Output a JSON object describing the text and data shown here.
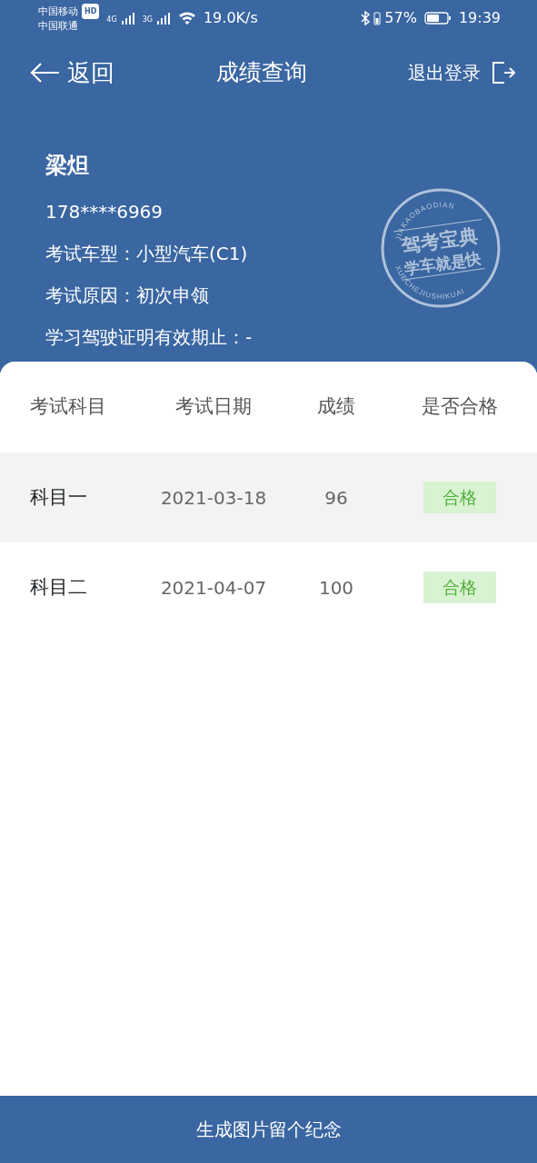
{
  "status_bar": {
    "carrier_1": "中国移动",
    "hd": "HD",
    "carrier_2": "中国联通",
    "net_1": "4G",
    "net_2": "3G",
    "speed": "19.0K/s",
    "battery": "57%",
    "time": "19:39"
  },
  "nav": {
    "back": "返回",
    "title": "成绩查询",
    "logout": "退出登录"
  },
  "profile": {
    "name": "梁炟",
    "phone": "178****6969",
    "fields": [
      {
        "label": "考试车型：",
        "value": "小型汽车(C1)"
      },
      {
        "label": "考试原因：",
        "value": "初次申领"
      },
      {
        "label": "学习驾驶证明有效期止：",
        "value": "-"
      }
    ]
  },
  "stamp": {
    "top_arc": "JIAKAOBAODIAN",
    "line_1": "驾考宝典",
    "line_2": "学车就是快",
    "bottom_arc": "XUECHEJIUSHIKUAI"
  },
  "table": {
    "columns": [
      "考试科目",
      "考试日期",
      "成绩",
      "是否合格"
    ],
    "rows": [
      {
        "subject": "科目一",
        "date": "2021-03-18",
        "score": "96",
        "result": "合格",
        "passed": true,
        "shaded": true
      },
      {
        "subject": "科目二",
        "date": "2021-04-07",
        "score": "100",
        "result": "合格",
        "passed": true,
        "shaded": false
      }
    ]
  },
  "footer_button": "生成图片留个纪念"
}
